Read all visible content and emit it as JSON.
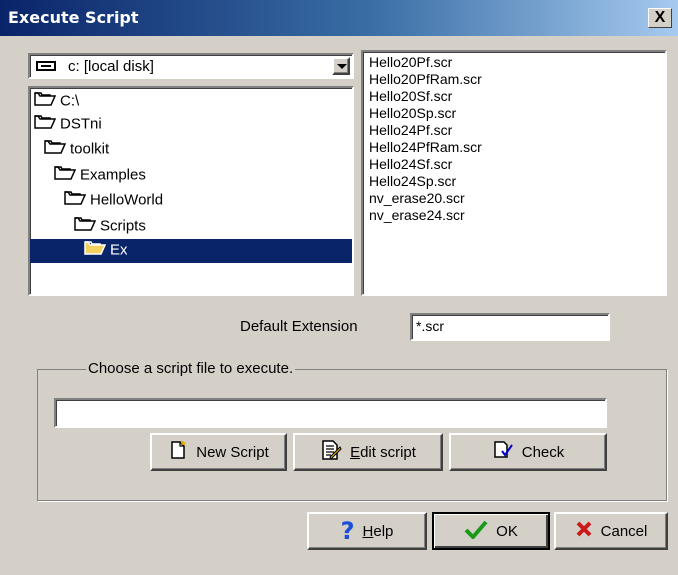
{
  "window": {
    "title": "Execute Script",
    "close_label": "X"
  },
  "drive": {
    "label": "c: [local disk]",
    "icon": "drive-icon"
  },
  "directories": [
    {
      "name": "C:\\",
      "icon": "open-folder-icon"
    },
    {
      "name": "DSTni",
      "icon": "open-folder-icon"
    },
    {
      "name": "toolkit",
      "icon": "open-folder-icon"
    },
    {
      "name": "Examples",
      "icon": "open-folder-icon"
    },
    {
      "name": "HelloWorld",
      "icon": "open-folder-icon"
    },
    {
      "name": "Scripts",
      "icon": "open-folder-icon"
    },
    {
      "name": "Ex",
      "icon": "open-folder-icon",
      "selected": true
    }
  ],
  "files": [
    "Hello20Pf.scr",
    "Hello20PfRam.scr",
    "Hello20Sf.scr",
    "Hello20Sp.scr",
    "Hello24Pf.scr",
    "Hello24PfRam.scr",
    "Hello24Sf.scr",
    "Hello24Sp.scr",
    "nv_erase20.scr",
    "nv_erase24.scr"
  ],
  "extension": {
    "label": "Default Extension",
    "value": "*.scr"
  },
  "group": {
    "legend": "Choose a script file to execute.",
    "script_path": ""
  },
  "buttons": {
    "new_script": "New Script",
    "edit_script_accel": "E",
    "edit_script_rest": "dit script",
    "check": "Check",
    "help_accel": "H",
    "help_rest": "elp",
    "ok": "OK",
    "cancel": "Cancel"
  },
  "colors": {
    "selection": "#0a246a",
    "titlebar": "#0a246a",
    "face": "#d4d0c8"
  }
}
